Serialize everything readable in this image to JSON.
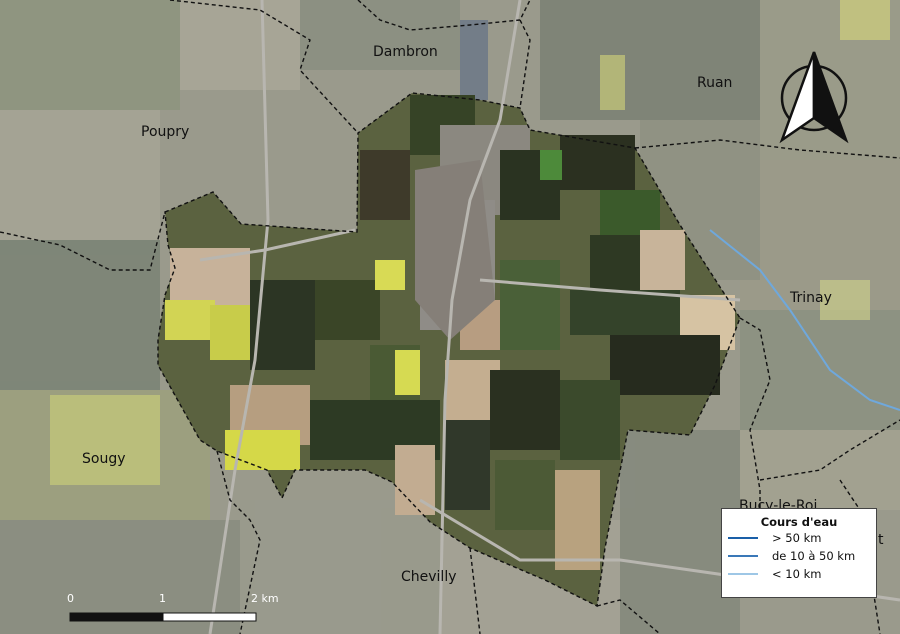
{
  "places": {
    "dambron": "Dambron",
    "ruan": "Ruan",
    "poupry": "Poupry",
    "trinay": "Trinay",
    "sougy": "Sougy",
    "bucy": "Bucy-le-Roi",
    "chevilly": "Chevilly",
    "partial": "t"
  },
  "legend": {
    "title": "Cours d'eau",
    "items": [
      {
        "label": "> 50 km",
        "color": "#1a5fa8"
      },
      {
        "label": "de 10 à 50 km",
        "color": "#3a78b8"
      },
      {
        "label": "< 10 km",
        "color": "#9ec7e6"
      }
    ]
  },
  "scale": {
    "l0": "0",
    "l1": "1",
    "l2": "2 km"
  },
  "colors": {
    "boundary": "#111111",
    "river": "#6fa8dc",
    "field_dark": "#2f3a23",
    "field_light": "#b9ac95",
    "rapeseed": "#d9dc5a",
    "town": "#9a9490"
  }
}
